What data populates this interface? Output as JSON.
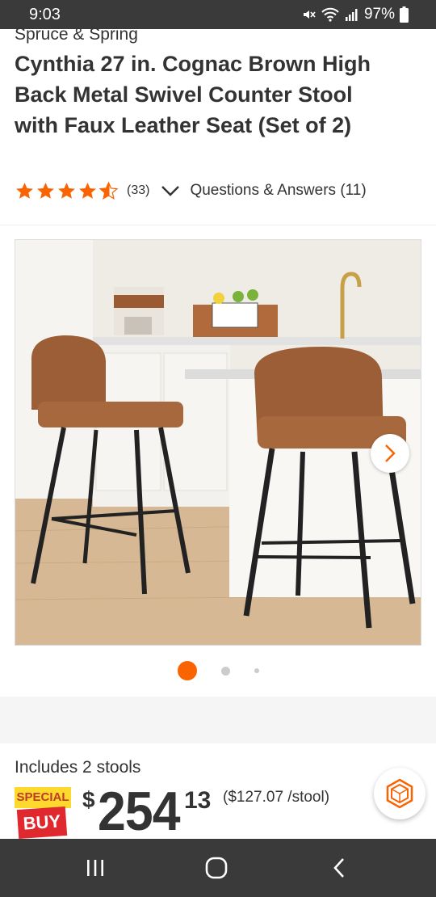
{
  "status_bar": {
    "time": "9:03",
    "battery": "97%",
    "icons": [
      "mute-icon",
      "wifi-icon",
      "signal-icon",
      "battery-icon"
    ]
  },
  "product": {
    "brand": "Spruce & Spring",
    "title": "Cynthia 27 in. Cognac Brown High Back Metal Swivel Counter Stool with Faux Leather Seat (Set of 2)",
    "rating": 4.5,
    "review_count": "(33)",
    "qa_label": "Questions & Answers (11)"
  },
  "gallery": {
    "image_count": 3,
    "active_index": 0
  },
  "pricing": {
    "includes": "Includes 2 stools",
    "badge_top": "SPECIAL",
    "badge_bottom": "BUY",
    "currency": "$",
    "dollars": "254",
    "cents": "13",
    "per_unit": "($127.07 /stool)"
  },
  "colors": {
    "accent": "#f96302",
    "star": "#f96302",
    "badge_yellow": "#fdd92e",
    "badge_red": "#e0282f",
    "system_bar": "#3a3a3a"
  }
}
